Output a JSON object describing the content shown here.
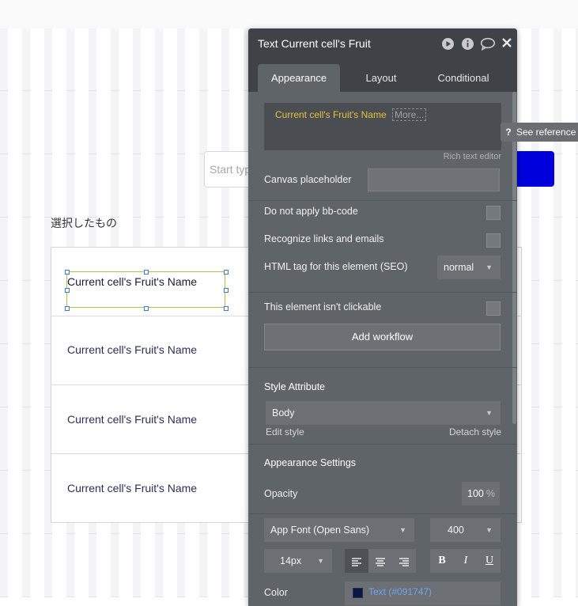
{
  "canvas": {
    "search_placeholder": "Start typing...",
    "selected_label": "選択したもの",
    "cell_texts": [
      "Current cell's Fruit's Name",
      "Current cell's Fruit's Name",
      "Current cell's Fruit's Name",
      "Current cell's Fruit's Name"
    ],
    "see_reference": "See reference",
    "button_color": "#0000dd"
  },
  "panel": {
    "title": "Text Current cell's Fruit",
    "header_icons": [
      "play-icon",
      "info-icon",
      "comment-icon",
      "close-icon"
    ],
    "tabs": [
      "Appearance",
      "Layout",
      "Conditional"
    ],
    "active_tab": "Appearance",
    "editor": {
      "dynamic_text": "Current cell's Fruit's Name",
      "more_label": "More...",
      "rich_text_label": "Rich text editor"
    },
    "canvas_placeholder_label": "Canvas placeholder",
    "no_bbcode_label": "Do not apply bb-code",
    "recognize_links_label": "Recognize links and emails",
    "html_tag_label": "HTML tag for this element (SEO)",
    "html_tag_value": "normal",
    "not_clickable_label": "This element isn't clickable",
    "add_workflow_label": "Add workflow",
    "style_attribute_label": "Style Attribute",
    "style_value": "Body",
    "edit_style_label": "Edit style",
    "detach_style_label": "Detach style",
    "appearance_settings_label": "Appearance Settings",
    "opacity_label": "Opacity",
    "opacity_value": "100",
    "opacity_unit": "%",
    "font_value": "App Font (Open Sans)",
    "font_weight_value": "400",
    "font_size_value": "14px",
    "bold_label": "B",
    "italic_label": "I",
    "underline_label": "U",
    "color_label": "Color",
    "color_value": "Text (#091747)",
    "color_hex": "#091747"
  }
}
